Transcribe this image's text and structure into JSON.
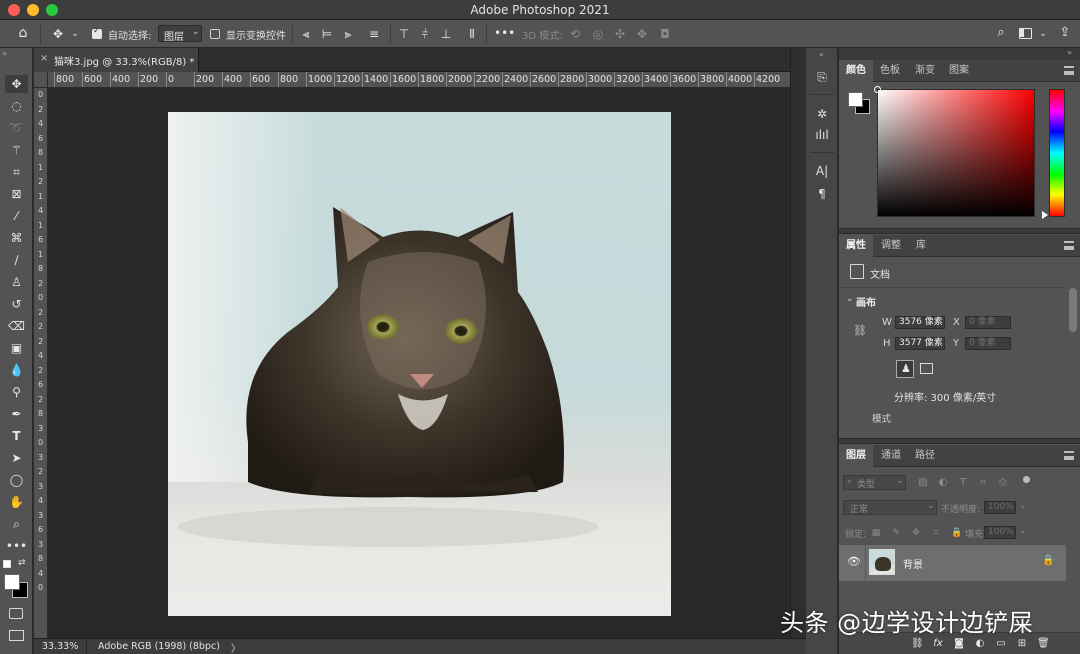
{
  "window": {
    "title": "Adobe Photoshop 2021"
  },
  "colors": {
    "close": "#fe5f57",
    "minimize": "#febc2e",
    "maximize": "#28c840",
    "accent": "#1473e6"
  },
  "options_bar": {
    "auto_select_label": "自动选择:",
    "auto_select_value": "图层",
    "show_transform_label": "显示变换控件",
    "mode_3d_label": "3D 模式:"
  },
  "document": {
    "tab_title": "猫咪3.jpg @ 33.3%(RGB/8) *",
    "ruler_ticks": [
      "800",
      "600",
      "400",
      "200",
      "0",
      "200",
      "400",
      "600",
      "800",
      "1000",
      "1200",
      "1400",
      "1600",
      "1800",
      "2000",
      "2200",
      "2400",
      "2600",
      "2800",
      "3000",
      "3200",
      "3400",
      "3600",
      "3800",
      "4000",
      "4200"
    ],
    "vruler_ticks": [
      "0",
      "2",
      "4",
      "6",
      "8",
      "1",
      "2",
      "1",
      "4",
      "1",
      "6",
      "1",
      "8",
      "2",
      "0",
      "2",
      "2",
      "2",
      "4",
      "2",
      "6",
      "2",
      "8",
      "3",
      "0",
      "3",
      "2",
      "3",
      "4",
      "3",
      "6",
      "3",
      "8",
      "4",
      "0"
    ]
  },
  "status_bar": {
    "zoom": "33.33%",
    "profile": "Adobe RGB (1998) (8bpc)",
    "arrow": "〉"
  },
  "tools": [
    "move-tool",
    "marquee-tool",
    "lasso-tool",
    "magic-wand-tool",
    "crop-tool",
    "frame-tool",
    "eyedropper-tool",
    "healing-brush-tool",
    "brush-tool",
    "clone-stamp-tool",
    "history-brush-tool",
    "eraser-tool",
    "gradient-tool",
    "blur-tool",
    "dodge-tool",
    "pen-tool",
    "type-tool",
    "path-selection-tool",
    "ellipse-tool",
    "hand-tool",
    "zoom-tool",
    "more-tools"
  ],
  "color_panel": {
    "tabs": [
      "颜色",
      "色板",
      "渐变",
      "图案"
    ]
  },
  "properties_panel": {
    "tabs": [
      "属性",
      "调整",
      "库"
    ],
    "doc_label": "文档",
    "canvas_label": "画布",
    "w_label": "W",
    "w_value": "3576 像素",
    "h_label": "H",
    "h_value": "3577 像素",
    "x_label": "X",
    "x_placeholder": "0 像素",
    "y_label": "Y",
    "y_placeholder": "0 像素",
    "resolution": "分辨率: 300 像素/英寸",
    "mode_label": "模式"
  },
  "layers_panel": {
    "tabs": [
      "图层",
      "通道",
      "路径"
    ],
    "filter_placeholder": "类型",
    "blend_mode": "正常",
    "opacity_label": "不透明度:",
    "opacity_value": "100%",
    "lock_label": "锁定:",
    "fill_label": "填充:",
    "fill_value": "100%",
    "layer_name": "背景"
  },
  "watermark": "头条 @边学设计边铲屎"
}
